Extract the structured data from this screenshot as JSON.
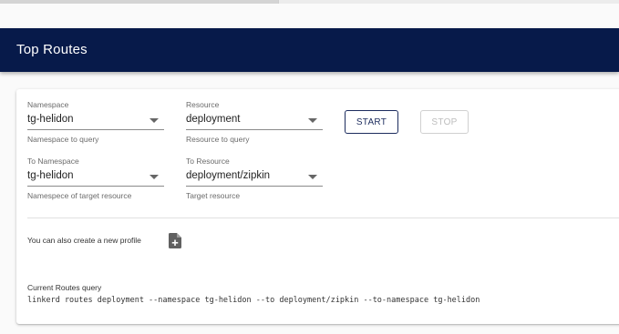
{
  "header": {
    "title": "Top Routes"
  },
  "form": {
    "namespace": {
      "label": "Namespace",
      "value": "tg-helidon",
      "help": "Namespace to query"
    },
    "resource": {
      "label": "Resource",
      "value": "deployment",
      "help": "Resource to query"
    },
    "to_namespace": {
      "label": "To Namespace",
      "value": "tg-helidon",
      "help": "Namespece of target resource"
    },
    "to_resource": {
      "label": "To Resource",
      "value": "deployment/zipkin",
      "help": "Target resource"
    }
  },
  "buttons": {
    "start": "START",
    "stop": "STOP"
  },
  "profile": {
    "text": "You can also create a new profile",
    "icon": "note-add-icon"
  },
  "query": {
    "label": "Current Routes query",
    "command": "linkerd routes deployment --namespace tg-helidon --to deployment/zipkin --to-namespace tg-helidon"
  },
  "colors": {
    "header_bg": "#071a4a",
    "primary": "#1c2c5e"
  }
}
